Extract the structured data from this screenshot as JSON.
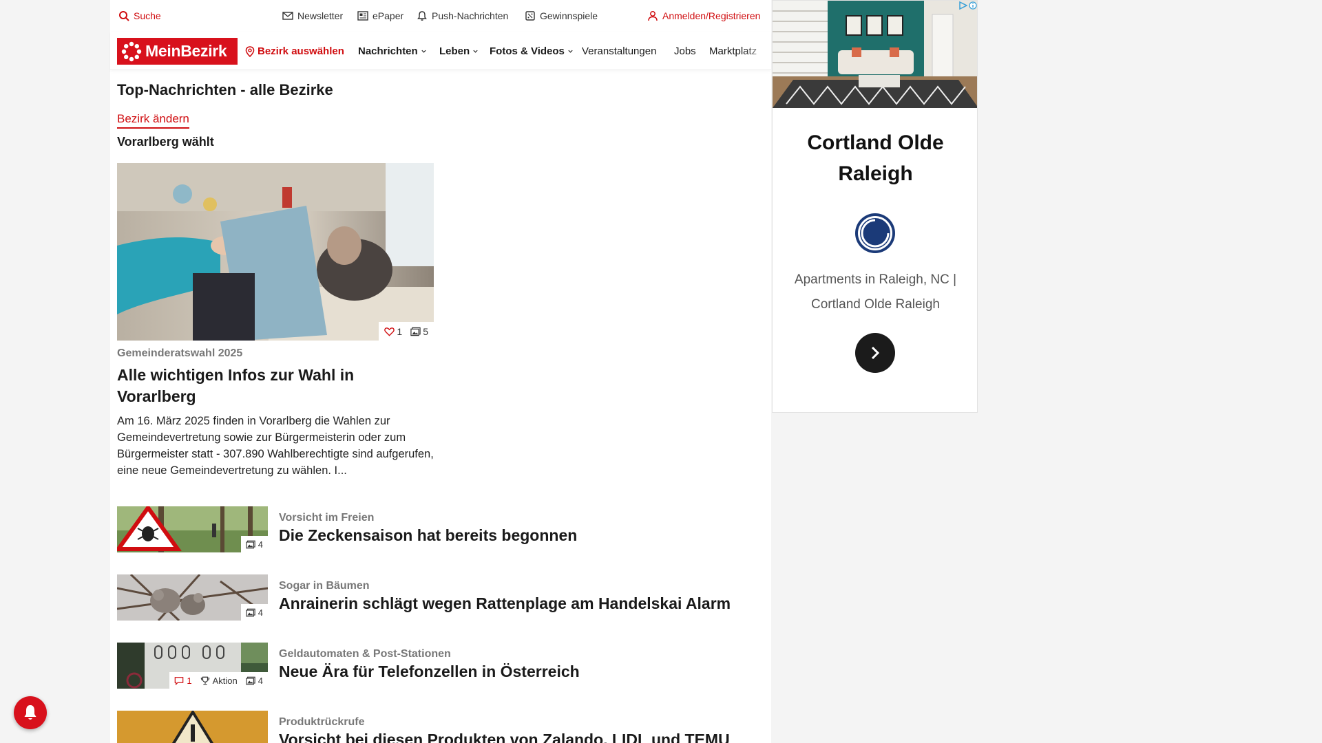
{
  "utility": {
    "search": "Suche",
    "newsletter": "Newsletter",
    "epaper": "ePaper",
    "push": "Push-Nachrichten",
    "contests": "Gewinnspiele",
    "login": "Anmelden/Registrieren"
  },
  "nav": {
    "logo": "MeinBezirk",
    "district": "Bezirk auswählen",
    "items": [
      {
        "label": "Nachrichten",
        "dropdown": true
      },
      {
        "label": "Leben",
        "dropdown": true
      },
      {
        "label": "Fotos & Videos",
        "dropdown": true
      },
      {
        "label": "Veranstaltungen",
        "dropdown": false
      },
      {
        "label": "Jobs",
        "dropdown": false
      },
      {
        "label": "Marktplatz",
        "dropdown": false
      }
    ]
  },
  "main": {
    "title": "Top-Nachrichten - alle Bezirke",
    "change_district": "Bezirk ändern",
    "section": "Vorarlberg wählt",
    "hero": {
      "likes": "1",
      "images": "5",
      "kicker": "Gemeinderatswahl 2025",
      "title": "Alle wichtigen Infos zur Wahl in Vorarlberg",
      "text": "Am 16. März 2025 finden in Vorarlberg die Wahlen zur Gemeindevertretung sowie zur Bürgermeisterin oder zum Bürgermeister statt - 307.890 Wahlberechtigte sind aufgerufen, eine neue Gemeindevertretung zu wählen. I..."
    },
    "articles": [
      {
        "kicker": "Vorsicht im Freien",
        "title": "Die Zeckensaison hat bereits begonnen",
        "images": "4"
      },
      {
        "kicker": "Sogar in Bäumen",
        "title": "Anrainerin schlägt wegen Rattenplage am Handelskai Alarm",
        "images": "4"
      },
      {
        "kicker": "Geldautomaten & Post-Stationen",
        "title": "Neue Ära für Telefonzellen in Österreich",
        "images": "4",
        "comments": "1",
        "action": "Aktion"
      },
      {
        "kicker": "Produktrückrufe",
        "title": "Vorsicht bei diesen Produkten von Zalando, LIDL und TEMU"
      }
    ]
  },
  "ad": {
    "title": "Cortland Olde Raleigh",
    "description": "Apartments in Raleigh, NC | Cortland Olde Raleigh"
  },
  "colors": {
    "brand": "#d8111c",
    "link": "#d00d10"
  }
}
